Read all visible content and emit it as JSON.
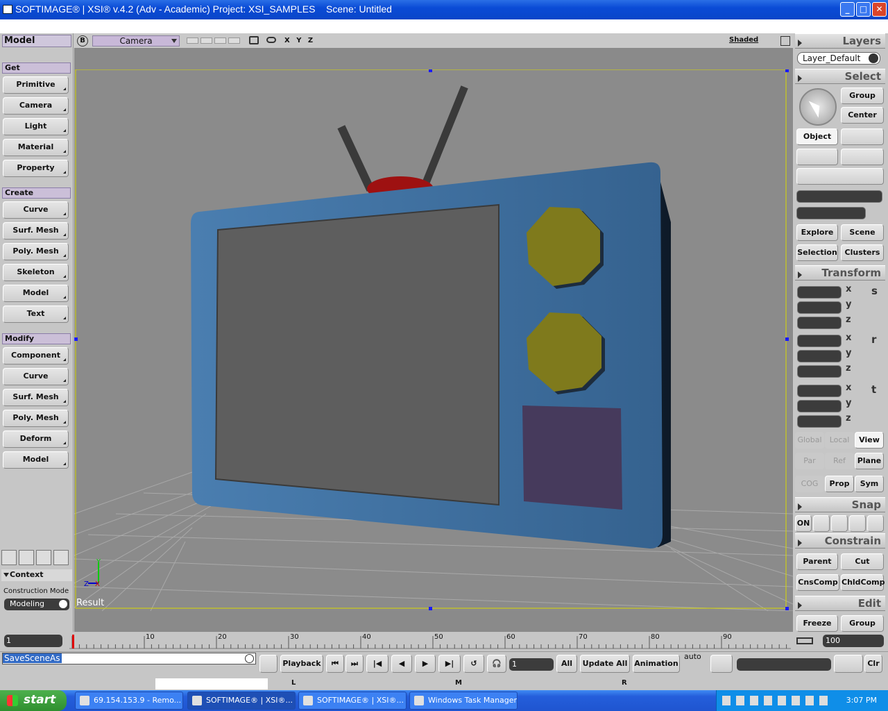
{
  "window": {
    "title": "SOFTIMAGE® | XSI® v.4.2 (Adv - Academic) Project: XSI_SAMPLES    Scene: Untitled",
    "min": "_",
    "max": "□",
    "close": "✕"
  },
  "left_panel": {
    "title": "Model",
    "get_label": "Get",
    "get_items": [
      "Primitive",
      "Camera",
      "Light",
      "Material",
      "Property"
    ],
    "create_label": "Create",
    "create_items": [
      "Curve",
      "Surf. Mesh",
      "Poly. Mesh",
      "Skeleton",
      "Model",
      "Text"
    ],
    "modify_label": "Modify",
    "modify_items": [
      "Component",
      "Curve",
      "Surf. Mesh",
      "Poly. Mesh",
      "Deform",
      "Model"
    ],
    "context_label": "Context",
    "construction_mode_label": "Construction Mode",
    "construction_mode_value": "Modeling"
  },
  "viewport": {
    "b_button": "B",
    "camera_label": "Camera",
    "axes_label": "X Y Z",
    "shading_label": "Shaded",
    "result_label": "Result"
  },
  "right_panel": {
    "layers_title": "Layers",
    "layer_value": "Layer_Default",
    "select_title": "Select",
    "group_label": "Group",
    "center_label": "Center",
    "object_label": "Object",
    "explore_label": "Explore",
    "scene_label": "Scene",
    "selection_label": "Selection",
    "clusters_label": "Clusters",
    "transform_title": "Transform",
    "axis_x": "x",
    "axis_y": "y",
    "axis_z": "z",
    "s_label": "s",
    "r_label": "r",
    "t_label": "t",
    "global_label": "Global",
    "local_label": "Local",
    "view_label": "View",
    "par_label": "Par",
    "ref_label": "Ref",
    "plane_label": "Plane",
    "cog_label": "COG",
    "prop_label": "Prop",
    "sym_label": "Sym",
    "snap_title": "Snap",
    "on_label": "ON",
    "constrain_title": "Constrain",
    "parent_label": "Parent",
    "cut_label": "Cut",
    "cnscomp_label": "CnsComp",
    "chldcomp_label": "ChldComp",
    "edit_title": "Edit",
    "freeze_label": "Freeze",
    "group2_label": "Group"
  },
  "timeline": {
    "start_value": "1",
    "end_value": "100",
    "ticks": [
      "10",
      "20",
      "30",
      "40",
      "50",
      "60",
      "70",
      "80",
      "90"
    ]
  },
  "bottom_bar": {
    "command_value": "SaveSceneAs",
    "playback_label": "Playback",
    "frame_value": "1",
    "all_label": "All",
    "update_all_label": "Update All",
    "animation_label": "Animation",
    "auto_label": "auto",
    "clr_label": "Clr"
  },
  "mouse_bar": {
    "l": "L",
    "m": "M",
    "r": "R"
  },
  "taskbar": {
    "start_label": "start",
    "tasks": [
      "69.154.153.9 - Remo...",
      "SOFTIMAGE® | XSI®...",
      "SOFTIMAGE® | XSI®...",
      "Windows Task Manager"
    ],
    "clock": "3:07 PM"
  },
  "colors": {
    "tv_body": "#3f6f9e",
    "screen": "#5d5d5d",
    "knob": "#7f7a1c",
    "panel_square": "#463a5c",
    "antenna_base": "#9e1111",
    "xp_blue": "#0a4bd6"
  }
}
